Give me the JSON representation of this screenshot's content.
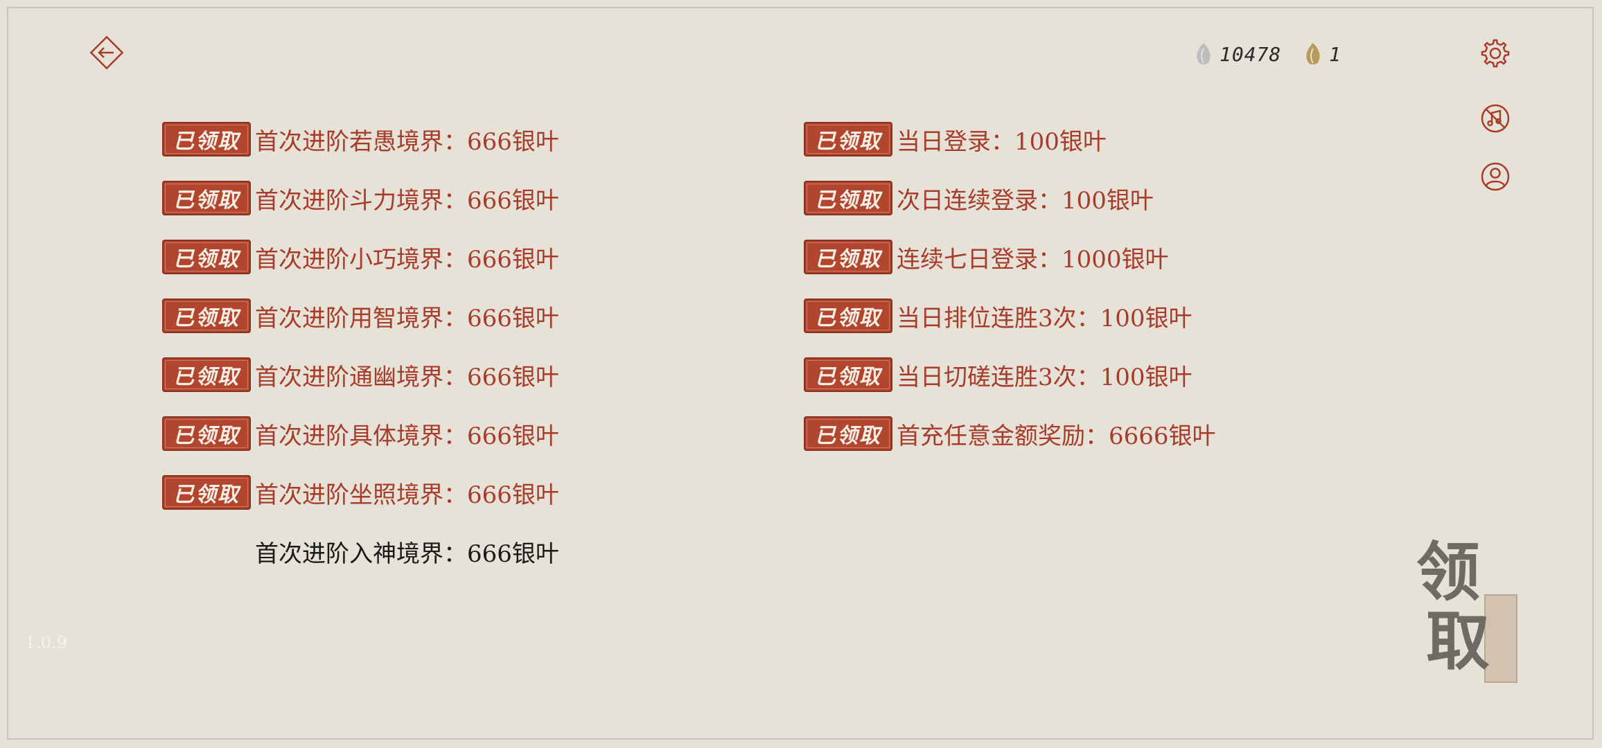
{
  "header": {
    "silver_leaf_count": "10478",
    "gold_leaf_count": "1"
  },
  "left_rewards": [
    {
      "status": "已领取",
      "text": "首次进阶若愚境界：666银叶"
    },
    {
      "status": "已领取",
      "text": "首次进阶斗力境界：666银叶"
    },
    {
      "status": "已领取",
      "text": "首次进阶小巧境界：666银叶"
    },
    {
      "status": "已领取",
      "text": "首次进阶用智境界：666银叶"
    },
    {
      "status": "已领取",
      "text": "首次进阶通幽境界：666银叶"
    },
    {
      "status": "已领取",
      "text": "首次进阶具体境界：666银叶"
    },
    {
      "status": "已领取",
      "text": "首次进阶坐照境界：666银叶"
    },
    {
      "status": "",
      "text": "首次进阶入神境界：666银叶"
    }
  ],
  "right_rewards": [
    {
      "status": "已领取",
      "text": "当日登录：100银叶"
    },
    {
      "status": "已领取",
      "text": "次日连续登录：100银叶"
    },
    {
      "status": "已领取",
      "text": "连续七日登录：1000银叶"
    },
    {
      "status": "已领取",
      "text": "当日排位连胜3次：100银叶"
    },
    {
      "status": "已领取",
      "text": "当日切磋连胜3次：100银叶"
    },
    {
      "status": "已领取",
      "text": "首充任意金额奖励：6666银叶"
    }
  ],
  "claim_button": {
    "char_top": "领",
    "char_bottom": "取"
  },
  "version": "1.0.9",
  "colors": {
    "background": "#e6e2d7",
    "accent": "#a83c2b",
    "stamp": "#b2452e",
    "silver_leaf": "#bdbdbd",
    "gold_leaf": "#b89a5a"
  },
  "icons": {
    "back": "back-arrow-icon",
    "settings": "gear-icon",
    "music": "music-off-icon",
    "profile": "user-icon",
    "silver_leaf": "silver-leaf-icon",
    "gold_leaf": "gold-leaf-icon"
  }
}
